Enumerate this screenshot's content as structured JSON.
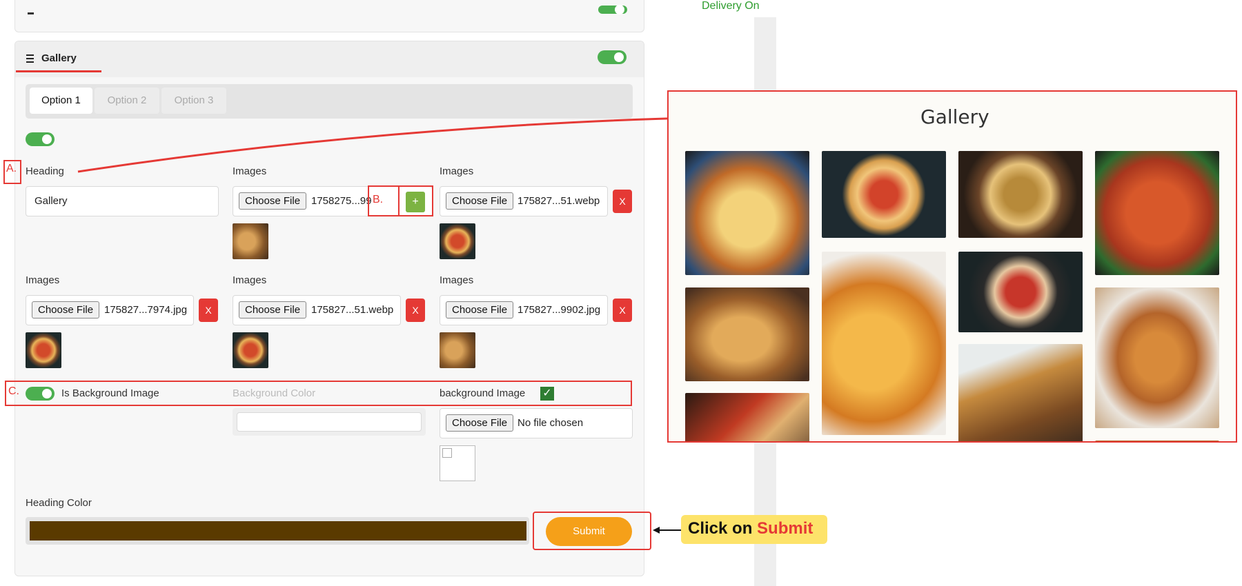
{
  "topbar": {
    "delivery_text": "Delivery On"
  },
  "gallery_section": {
    "title": "Gallery",
    "tabs": [
      {
        "label": "Option 1"
      },
      {
        "label": "Option 2"
      },
      {
        "label": "Option 3"
      }
    ],
    "heading_label": "Heading",
    "heading_value": "Gallery",
    "images_label": "Images",
    "choose_file": "Choose File",
    "file_names": [
      "1758275...99",
      "175827...51.webp",
      "175827...7974.jpg",
      "175827...51.webp",
      "175827...9902.jpg"
    ],
    "add_btn": "+",
    "remove_btn": "X",
    "bg_toggle_label": "Is Background Image",
    "bg_color_label": "Background Color",
    "bg_image_label": "background Image",
    "no_file": "No file chosen",
    "heading_color_label": "Heading Color",
    "submit": "Submit"
  },
  "annotations": {
    "a": "A.",
    "b": "B.",
    "c": "C.",
    "click_prefix": "Click on ",
    "click_action": "Submit"
  },
  "preview": {
    "title": "Gallery"
  },
  "colors": {
    "accent_red": "#e53935",
    "toggle_green": "#4caf50",
    "submit_orange": "#f5a019",
    "heading_color_swatch": "#5a3a00",
    "callout_yellow": "#fde36a"
  }
}
